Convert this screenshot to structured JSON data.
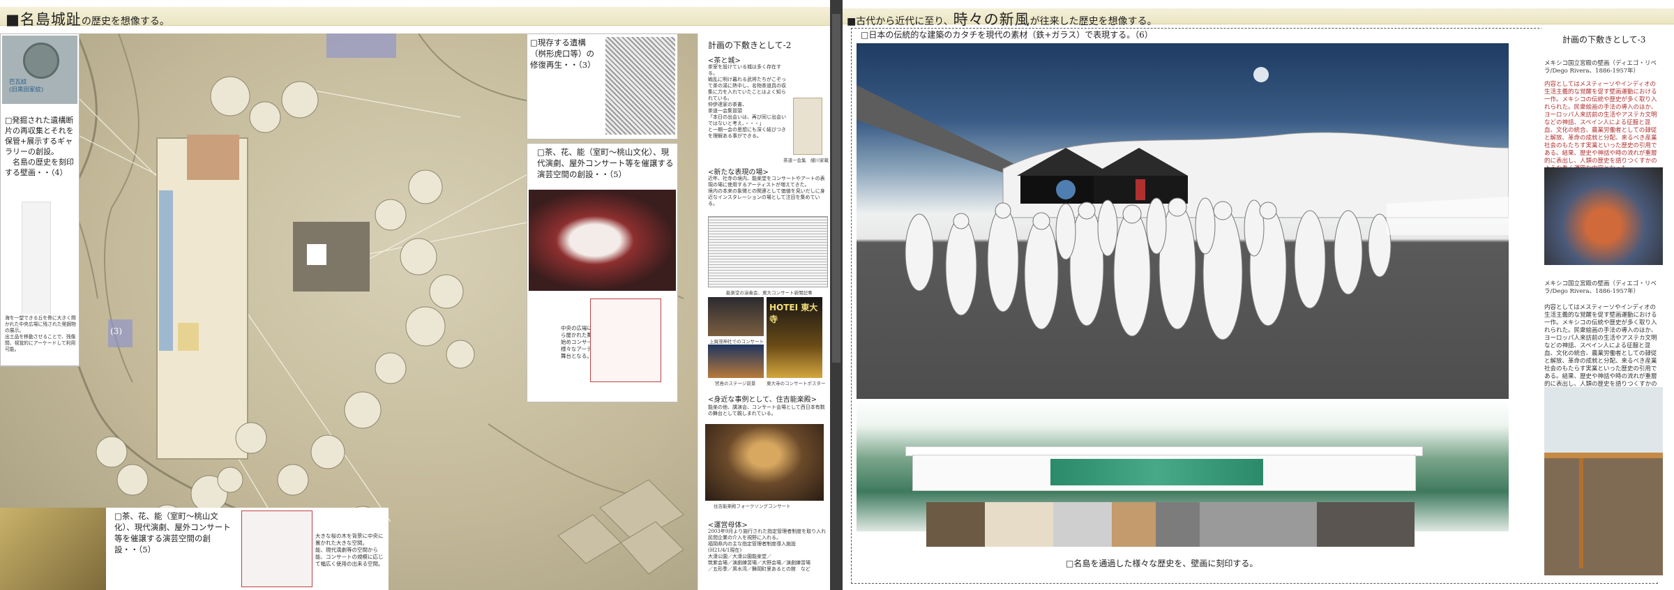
{
  "left": {
    "title_main": "■名島城趾",
    "title_sub": "の歴史を想像する。",
    "stamp_label": "巴瓦紋\n(旧黒田家紋)",
    "callout_gallery": "□発掘された遺構断片の再収集とそれを保管+展示するギャラリーの創設。\n　名島の歴史を刻印する壁画・・（4）",
    "callout_gallery_small": "海を一望できる丘を骨に大きく開かれた中央広場に残された発掘物の展示。\n出土品を移動させることで、残像間、視覚的にアーケードして利用可能。",
    "callout_restore": "□現存する遺構（桝形虎口等）の修復再生・・（3）",
    "callout_tea": "□茶、花、能（室町～桃山文化）、現代演劇、屋外コンサート等を催譲する演芸空間の創設・・（5）",
    "callout_tea_small": "中央の広場に大きくひら屋かれた舞台は能を始めコンサートなど様々なアーティストの舞台となる。",
    "bottom_callout": "□茶、花、能（室町～桃山文化）、現代演劇、屋外コンサート等を催譲する演芸空間の創設・・（5）",
    "bottom_small": "大きな桜の木を背景に中央に置かれた大きな空間。\n能、現代演劇等の空間から能、コンサートの規模に応じて幅広く使用の出来る空間。",
    "marker_3": "(3)",
    "column": {
      "heading": "計画の下敷きとして-2",
      "s1_head": "<茶と城>",
      "s1_text": "茶室を設けている城は多く存在する。\n戦乱に明け暮れる武将たちがこぞって茶の湯に熱中し、名物茶道具の収集に力を入れていたことはよく知られている。\n仲伊達家の茶書、\n茶道一会集冒頭\n「本日の出会いは、再び同じ出会いではないと考え、・・・」\nと一期一会の思想にも深く結びつきを理解ある事ができる。",
      "s1_cap": "茶道一会集　細川家蔵",
      "s2_head": "<新たな表現の場>",
      "s2_text": "近年、社寺の境内、能楽堂をコンサートやアートの表現の場に使用するアーティストが増えてきた。\n境内の本来の象徴との関連として価値を見いだしに身近なインスタレーションの場として注目を集めている。",
      "s2_cap": "能楽堂の演奏会、東大コンサート新聞記事",
      "s3_cap1": "上賀茂神社でのコンサート",
      "s3_cap2": "宮島のステージ前景",
      "s3_cap3": "東大寺のコンサートポスター",
      "poster_title": "HOTEI 東大寺",
      "s4_head": "<身近な事例として、住吉能楽殿>",
      "s4_text": "能楽の他、講演会、コンサート会場として西日本有数の舞台として親しまれている。",
      "s4_cap": "住吉能楽殿フォークソングコンサート",
      "s5_head": "<運営母体>",
      "s5_text": "2003年9月より施行された指定管理者制度を取り入れ民間企業の介入を視野に入れる。\n福岡県内の主な指定管理者制度導入施設\n(H21/4/1現在)\n大濠公園／大濠公園能楽堂／\n筑紫会場／演劇練習場／大野会場／演劇練習場\n／五形季／男水湾／舞岡町里あるとの館　など"
    }
  },
  "right": {
    "title_pre": "■古代から近代に至り、",
    "title_big": "時々の新風",
    "title_post": "が往来した歴史を想像する。",
    "caption_render": "□日本の伝統的な建築のカタチを現代の素材（鉄+ガラス）で表現する。（6）",
    "caption_wall": "□名島を通過した様々な歴史を、壁画に刻印する。",
    "column": {
      "heading": "計画の下敷きとして-3",
      "mural1_title": "メキシコ国立宮殿の壁画（ディエゴ・リベラ/Dego Rivera、1886-1957年）",
      "mural1_text": "内容としてはメスティーソやインディオの生活主義的な覚醒を促す壁画運動における一作。メキシコの伝統や歴史が多く取り入れられた。民衆絵画の手法の導入のほか、ヨーロッパ人来訪前の生活やアステカ文明などの神話、スペイン人による征服と混血、文化の統合、農業労働者としての隷従と解放、革命の成就と分配、来るべき産業社会のもたちす実業といった歴史の引用である。結果、歴史や神話や時の流れが重層的に表出し、人類の歴史を語りつくすかのような重く濃密な内容となった。",
      "mural2_title": "メキシコ国立宮殿の壁画（ディエゴ・リベラ/Dego Rivera、1886-1957年）",
      "mural2_text": "内容としてはメスティーソやインディオの生活主義的な覚醒を促す壁画運動における一作。メキシコの伝統や歴史が多く取り入れられた。民衆絵画の手法の導入のほか、ヨーロッパ人来訪前の生活やアステカ文明などの神話、スペイン人による征服と混血、文化の統合、農業労働者としての隷従と解放、革命の成就と分配、来るべき産業社会のもたらす実業といった歴史の引用である。結果、歴史や神話や時の流れが重層的に表出し、人類の歴史を語りつくすかのような重く濃密な内容となった。"
    }
  },
  "colors": {
    "frame_dark": "#3a3a3a",
    "header_band": "#f4f0d8",
    "accent_red": "#c0392b",
    "sky_blue": "#2a4a72"
  }
}
